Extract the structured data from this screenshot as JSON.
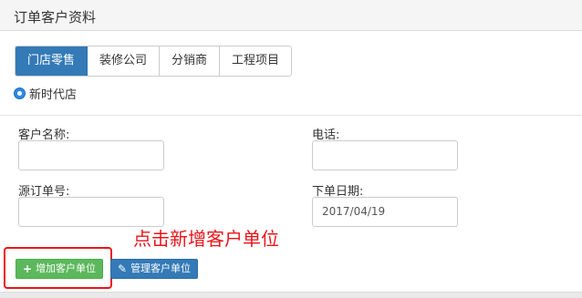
{
  "panel": {
    "title": "订单客户资料"
  },
  "tabs": [
    {
      "label": "门店零售",
      "active": true
    },
    {
      "label": "装修公司",
      "active": false
    },
    {
      "label": "分销商",
      "active": false
    },
    {
      "label": "工程项目",
      "active": false
    }
  ],
  "store_radio": {
    "label": "新时代店",
    "selected": true
  },
  "form": {
    "customer_name": {
      "label": "客户名称:",
      "value": ""
    },
    "phone": {
      "label": "电话:",
      "value": ""
    },
    "source_order_no": {
      "label": "源订单号:",
      "value": ""
    },
    "order_date": {
      "label": "下单日期:",
      "value": "2017/04/19"
    }
  },
  "annotation": {
    "text": "点击新增客户单位",
    "color": "#e8151b"
  },
  "buttons": {
    "add_customer_unit": {
      "label": "增加客户单位",
      "icon": "plus-icon"
    },
    "manage_customer_unit": {
      "label": "管理客户单位",
      "icon": "pencil-icon"
    }
  },
  "colors": {
    "primary": "#337ab7",
    "success": "#5cb85c",
    "annotation": "#e8151b"
  }
}
